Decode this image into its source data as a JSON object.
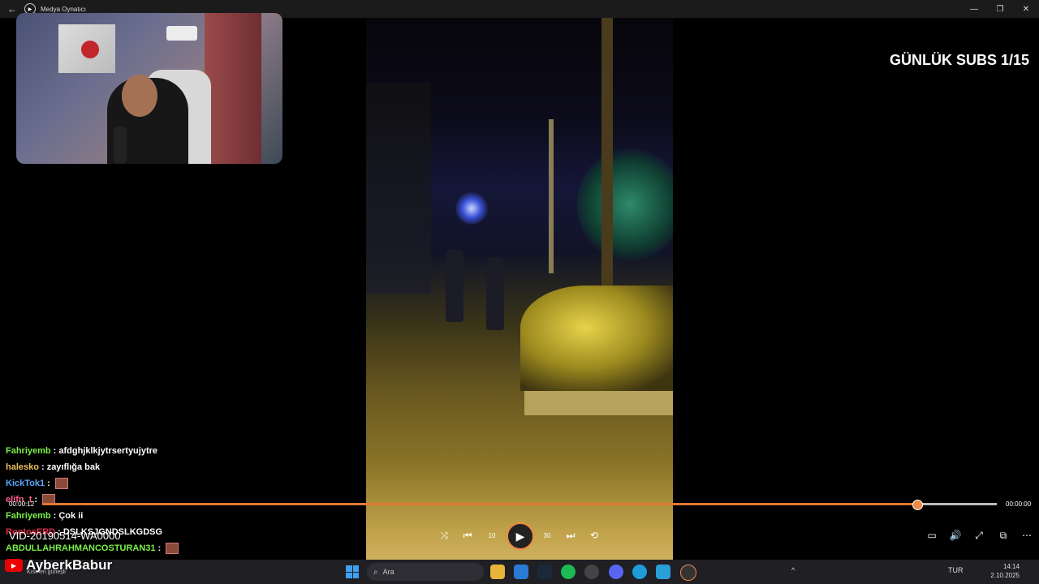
{
  "titlebar": {
    "title": "Medya Oynatıcı",
    "back_icon": "back-arrow-icon",
    "app_icon": "media-player-icon",
    "minimize_glyph": "—",
    "maximize_glyph": "❐",
    "close_glyph": "✕"
  },
  "overlay": {
    "subs_counter": "GÜNLÜK SUBS 1/15"
  },
  "chat": {
    "messages": [
      {
        "user": "Fahriyemb",
        "text": ": afdghjklkjytrsertyujytre",
        "color": "#7cf04a"
      },
      {
        "user": "halesko",
        "text": ": zayıflığa bak",
        "color": "#f0c060"
      },
      {
        "user": "KickTok1",
        "text": ":",
        "color": "#5aa8ff",
        "emote": true
      },
      {
        "user": "elifn_t",
        "text": ":",
        "color": "#ff5a8a",
        "emote": true
      },
      {
        "user": "Fahriyemb",
        "text": ": Çok ii",
        "color": "#7cf04a"
      },
      {
        "user": "RootosERD",
        "text": ": DSLKSJGNDSLKGDSG",
        "color": "#e0304a"
      },
      {
        "user": "ABDULLAHRAHMANCOSTURAN31",
        "text": ":",
        "color": "#7cf04a",
        "emote": true
      }
    ]
  },
  "player": {
    "current_time": "00:00:12",
    "total_time": "00:00:00",
    "progress": 0.917,
    "file_name": "VID-20190514-WA0000",
    "accent": "#f08a44"
  },
  "controls": {
    "shuffle": "⤨",
    "previous": "⏮",
    "rewind": "↺",
    "rewind_label": "10",
    "play": "▶",
    "forward": "↻",
    "forward_label": "30",
    "next": "⏭",
    "repeat": "⟲",
    "subtitles": "▭",
    "volume": "🔊",
    "fullscreen": "⤢",
    "miniplayer": "⧉",
    "more": "⋯"
  },
  "brand": {
    "channel": "AyberkBabur"
  },
  "taskbar": {
    "weather_text": "Kısmen güneşli",
    "search_placeholder": "Ara",
    "language": "TUR",
    "time": "14:14",
    "date": "2.10.2025"
  }
}
